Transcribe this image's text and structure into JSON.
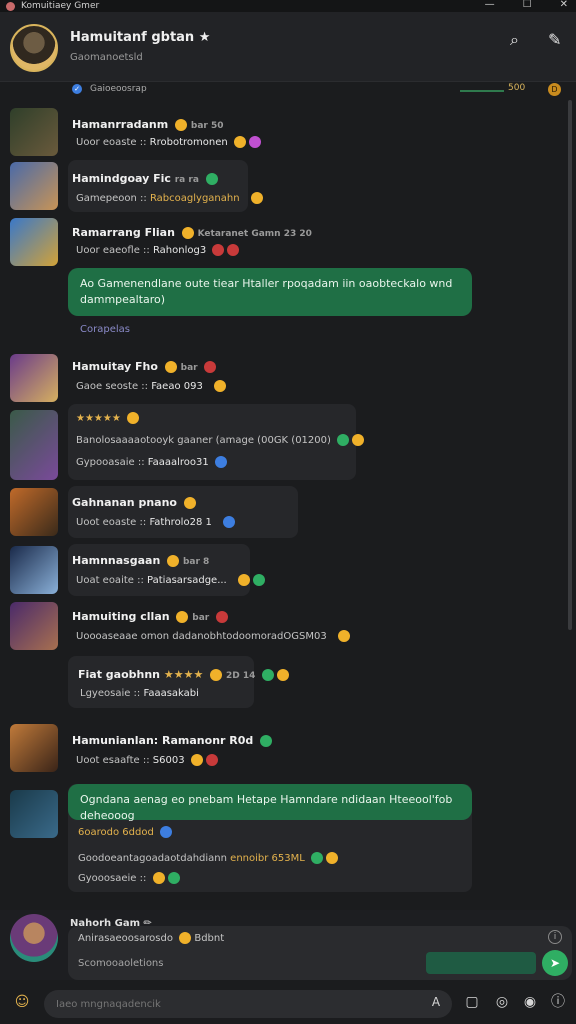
{
  "titlebar": {
    "title": "Komuitiaey Gmer",
    "minimize": "—",
    "maximize": "☐",
    "close": "✕"
  },
  "header": {
    "name": "Hamuitanf gbtan ★",
    "subtitle": "Gaomanoetsld",
    "search_icon": "search-icon",
    "action_icon": "pin-icon"
  },
  "filterbar": {
    "label": "Gaioeoosrap",
    "value": "500",
    "coin": "D"
  },
  "messages": [
    {
      "name": "Hamanrradanm",
      "meta": "bar 50",
      "line": "Uoor eoaste ::",
      "value": "Rrobotromonen"
    },
    {
      "name": "Hamindgoay Fic",
      "meta": "ra ra",
      "line": "Gamepeoon ::",
      "value": "Rabcoaglyganahn"
    },
    {
      "name": "Ramarrang Flian",
      "meta": "Ketaranet  Gamn  23  20",
      "line": "Uoor eaeofle ::",
      "value": "Rahonlog3"
    },
    {
      "bubble": "Ao Gamenendlane oute tiear Htaller rpoqadam iin oaobteckalo wnd dammpealtaro)",
      "footer": "Corapelas"
    },
    {
      "name": "Hamuitay Fho",
      "meta": "bar",
      "line": "Gaoe seoste ::",
      "value": "Faeao 093"
    },
    {
      "stars": "★★★★★",
      "line": "Banolosaaaaotooyk gaaner (amage (00GK (01200)",
      "subline": "Gypooasaie ::",
      "subvalue": "Faaaalroo31"
    },
    {
      "name": "Gahnanan pnano",
      "line": "Uoot eoaste ::",
      "value": "Fathrolo28 1"
    },
    {
      "name": "Hamnnasgaan",
      "meta": "bar 8",
      "line": "Uoat eoaite ::",
      "value": "Patiasarsadge..."
    },
    {
      "name": "Hamuiting cllan",
      "meta": "bar",
      "line": "Uoooaseaae  omon  dadanobhtodoomoradOGSM03"
    },
    {
      "name": "Fiat gaobhnn",
      "stars": "★★★★",
      "meta": "2D 14",
      "line": "Lgyeosaie ::",
      "value": "Faaasakabi"
    },
    {
      "name": "Hamunianlan:  Ramanonr R0d",
      "line": "Uoot esaafte ::",
      "value": "S6003"
    },
    {
      "bubble": "Ogndana aenag eo pnebam Hetape Hamndare ndidaan Hteeool'fob deheooog",
      "bubble_sub": "6oarodo 6ddod",
      "line": "Goodoeantagoadaotdahdiann",
      "value": "ennoibr 653ML",
      "subline": "Gyooosaeie ::"
    }
  ],
  "composer": {
    "author": "Nahorh Gam ✏",
    "line1": "Anirasaeoosarosdo",
    "line1_value": "Bdbnt",
    "line2": "Scomooaoletions",
    "send": "➤"
  },
  "bottombar": {
    "placeholder": "Iaeo mngnaqadencik"
  }
}
